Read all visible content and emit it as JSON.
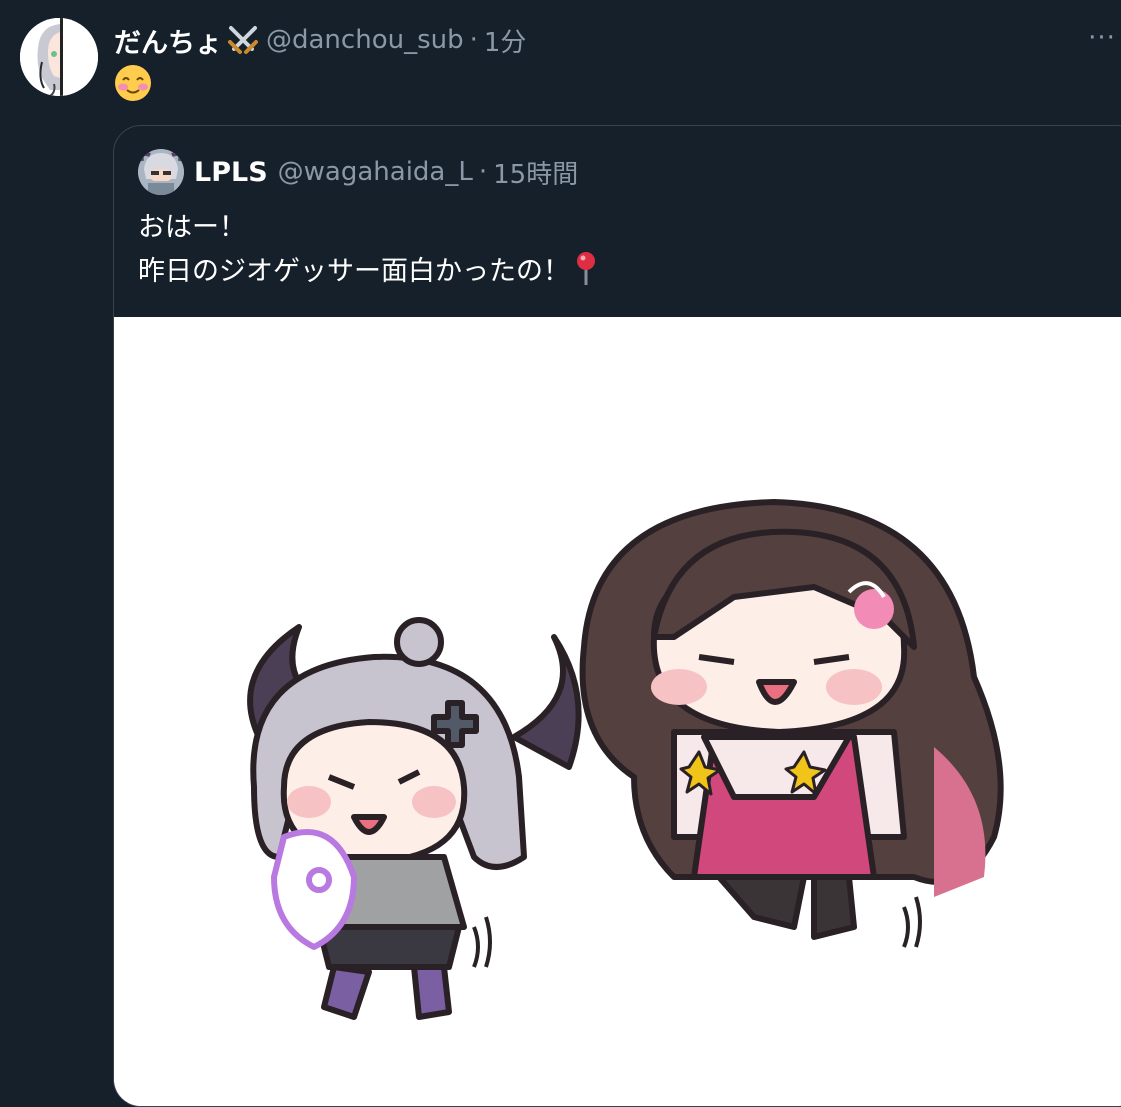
{
  "tweet": {
    "author": {
      "display_name": "だんちょ",
      "handle": "@danchou_sub",
      "name_emoji": "crossed-swords-icon"
    },
    "separator": "·",
    "time": "1分",
    "body_emoji": "smiling-face-with-smiling-eyes-icon",
    "more_label": "···"
  },
  "quote": {
    "author": {
      "display_name": "LPLS",
      "handle": "@wagahaida_L"
    },
    "separator": "·",
    "time": "15時間",
    "lines": [
      "おはー！",
      "昨日のジオゲッサー面白かったの！"
    ],
    "trailing_emoji": "round-pushpin-icon",
    "media": {
      "description_icon": "illustration-image"
    }
  },
  "colors": {
    "background": "#15202b",
    "secondary_text": "#8b98a5",
    "border": "#38444d"
  }
}
